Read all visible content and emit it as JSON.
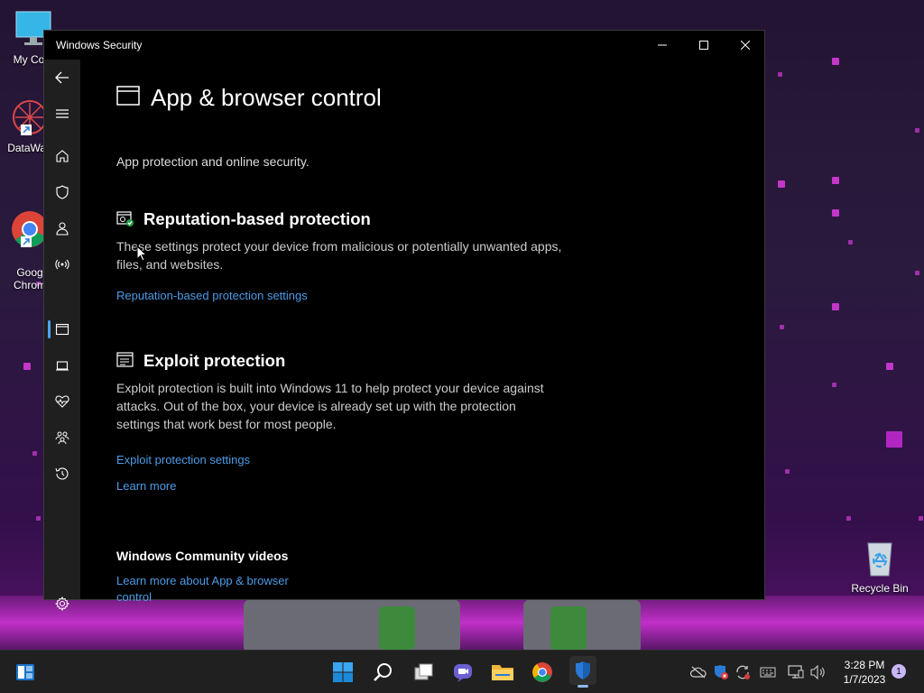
{
  "desktop": {
    "icons": [
      {
        "label": "My Com",
        "icon": "monitor-icon"
      },
      {
        "label": "DataWag",
        "icon": "app-icon"
      },
      {
        "label": "Goog\nChrom",
        "icon": "chrome-icon"
      },
      {
        "label": "Recycle Bin",
        "icon": "recycle-bin-icon"
      }
    ]
  },
  "window": {
    "title": "Windows Security",
    "controls": {
      "minimize": "minimize-icon",
      "maximize": "maximize-icon",
      "close": "close-icon"
    }
  },
  "nav": {
    "items": [
      "back-icon",
      "menu-icon",
      "home-icon",
      "shield-icon",
      "account-icon",
      "firewall-icon",
      "app-browser-icon",
      "device-security-icon",
      "health-icon",
      "family-icon",
      "history-icon",
      "settings-icon"
    ],
    "active": "app-browser-icon"
  },
  "page": {
    "title": "App & browser control",
    "subtitle": "App protection and online security.",
    "reputation": {
      "title": "Reputation-based protection",
      "desc": "These settings protect your device from malicious or potentially unwanted apps, files, and websites.",
      "link": "Reputation-based protection settings"
    },
    "exploit": {
      "title": "Exploit protection",
      "desc": "Exploit protection is built into Windows 11 to help protect your device against attacks.  Out of the box, your device is already set up with the protection settings that work best for most people.",
      "link_settings": "Exploit protection settings",
      "link_learn": "Learn more"
    },
    "community": {
      "title": "Windows Community videos",
      "link": "Learn more about App & browser control"
    }
  },
  "taskbar": {
    "apps": [
      "widgets-icon",
      "start-icon",
      "search-icon",
      "task-view-icon",
      "teams-chat-icon",
      "file-explorer-icon",
      "chrome-icon",
      "windows-security-icon"
    ],
    "tray": [
      "onedrive-icon",
      "security-warning-icon",
      "sync-icon",
      "keyboard-icon",
      "network-icon",
      "volume-icon"
    ],
    "time": "3:28 PM",
    "date": "1/7/2023",
    "notifications": "1"
  },
  "colors": {
    "accent_link": "#4d9be6",
    "window_bg": "#000000",
    "rail_bg": "#1f1f1f",
    "wallpaper": "#2a1a3e",
    "wallpaper_dots": "#d43ad8"
  }
}
